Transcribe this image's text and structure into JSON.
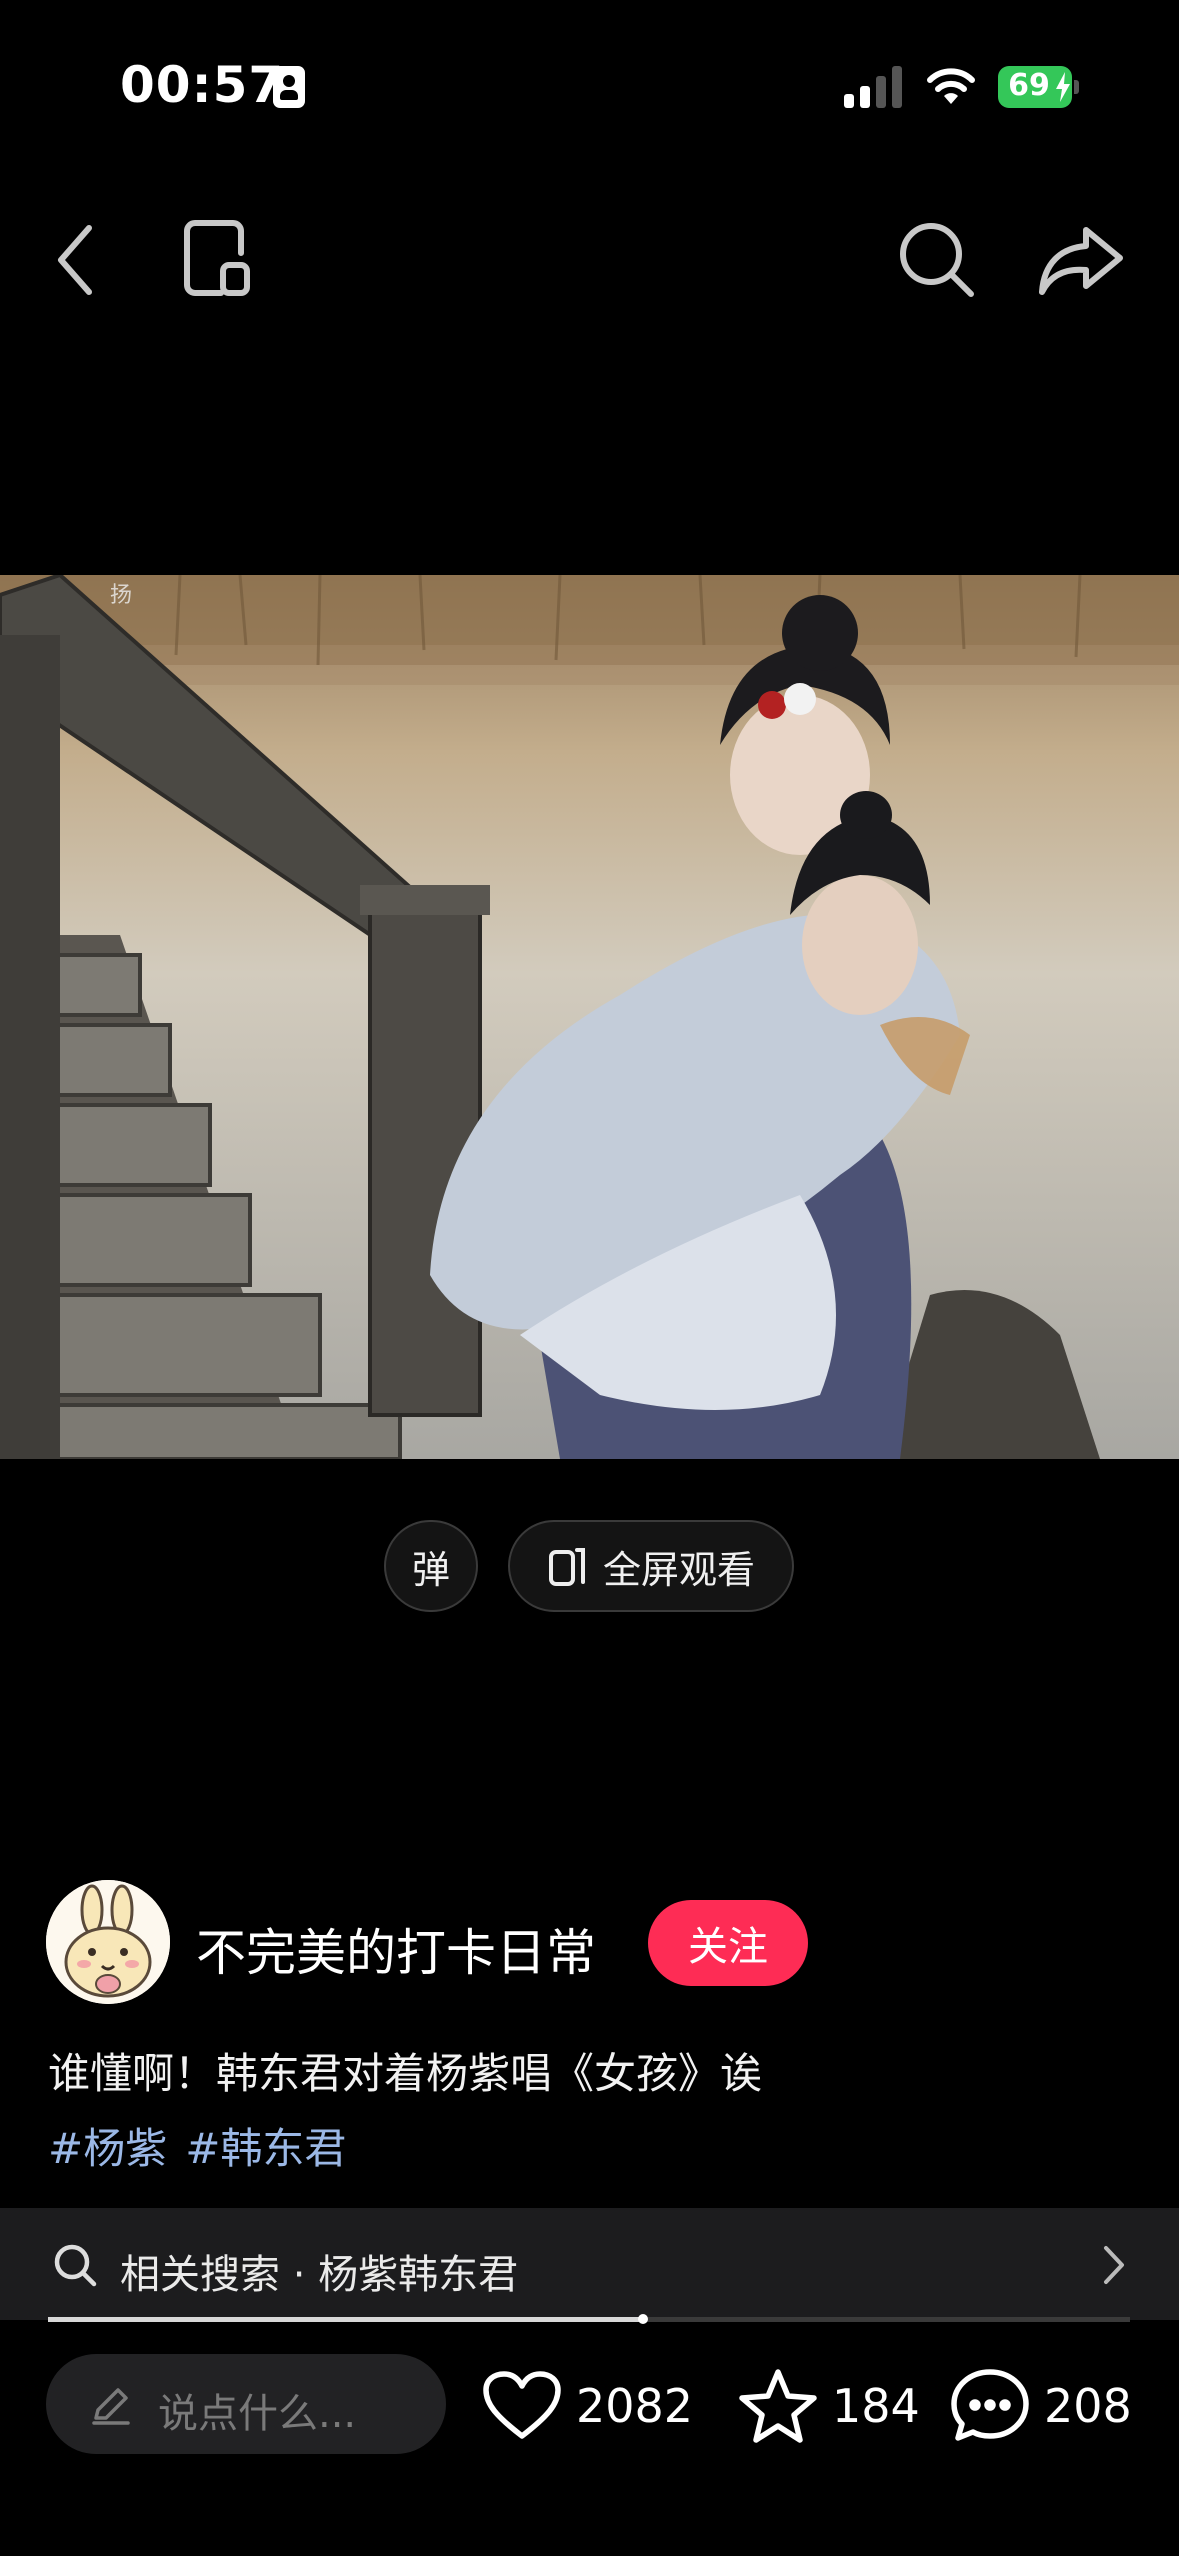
{
  "status_bar": {
    "time": "00:57",
    "battery": "69",
    "signal_bars": 2
  },
  "video": {
    "watermark": "扬"
  },
  "controls": {
    "danmu_label": "弹",
    "fullscreen_label": "全屏观看"
  },
  "author": {
    "name": "不完美的打卡日常",
    "follow_label": "关注"
  },
  "post": {
    "caption": "谁懂啊！韩东君对着杨紫唱《女孩》诶",
    "tags": [
      "#杨紫",
      "#韩东君"
    ]
  },
  "related_search": {
    "label": "相关搜索 · 杨紫韩东君"
  },
  "playback": {
    "progress": 0.55
  },
  "bottom_bar": {
    "comment_placeholder": "说点什么...",
    "likes": "2082",
    "favorites": "184",
    "comments": "208"
  },
  "colors": {
    "follow": "#fe2c55",
    "battery": "#34c759",
    "hashtag": "#9bb8e6"
  }
}
